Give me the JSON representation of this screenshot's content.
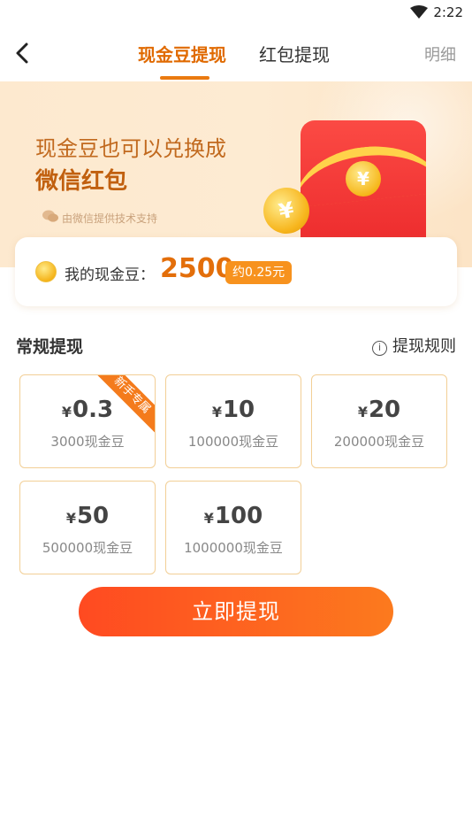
{
  "status_bar": {
    "time": "2:22"
  },
  "nav": {
    "tabs": [
      {
        "label": "现金豆提现",
        "active": true
      },
      {
        "label": "红包提现",
        "active": false
      }
    ],
    "detail_label": "明细"
  },
  "banner": {
    "line1": "现金豆也可以兑换成",
    "line2": "微信红包",
    "note": "由微信提供技术支持",
    "coin_symbol": "¥"
  },
  "balance": {
    "label": "我的现金豆：",
    "value": "2500",
    "approx": "约0.25元"
  },
  "section": {
    "title": "常规提现",
    "rules_label": "提现规则",
    "info_glyph": "i"
  },
  "options": [
    {
      "currency": "¥",
      "amount": "0.3",
      "beans": "3000现金豆",
      "ribbon": "新手专属"
    },
    {
      "currency": "¥",
      "amount": "10",
      "beans": "100000现金豆"
    },
    {
      "currency": "¥",
      "amount": "20",
      "beans": "200000现金豆"
    },
    {
      "currency": "¥",
      "amount": "50",
      "beans": "500000现金豆"
    },
    {
      "currency": "¥",
      "amount": "100",
      "beans": "1000000现金豆"
    }
  ],
  "submit_label": "立即提现",
  "colors": {
    "accent": "#e06a00",
    "button_start": "#ff4a21",
    "button_end": "#fc7a1e",
    "card_border": "#f2cf96"
  }
}
